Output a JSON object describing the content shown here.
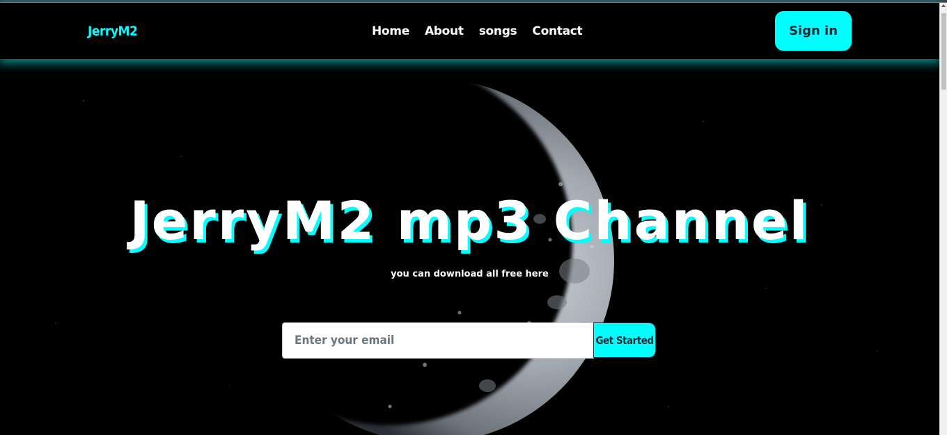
{
  "nav": {
    "brand": "JerryM2",
    "links": [
      "Home",
      "About",
      "songs",
      "Contact"
    ],
    "signin_label": "Sign in"
  },
  "hero": {
    "title": "JerryM2 mp3 Channel",
    "subtitle": "you can download all free here",
    "email_placeholder": "Enter your email",
    "cta_label": "Get Started"
  },
  "colors": {
    "accent": "#00ffff",
    "background": "#000000",
    "text": "#ffffff"
  }
}
